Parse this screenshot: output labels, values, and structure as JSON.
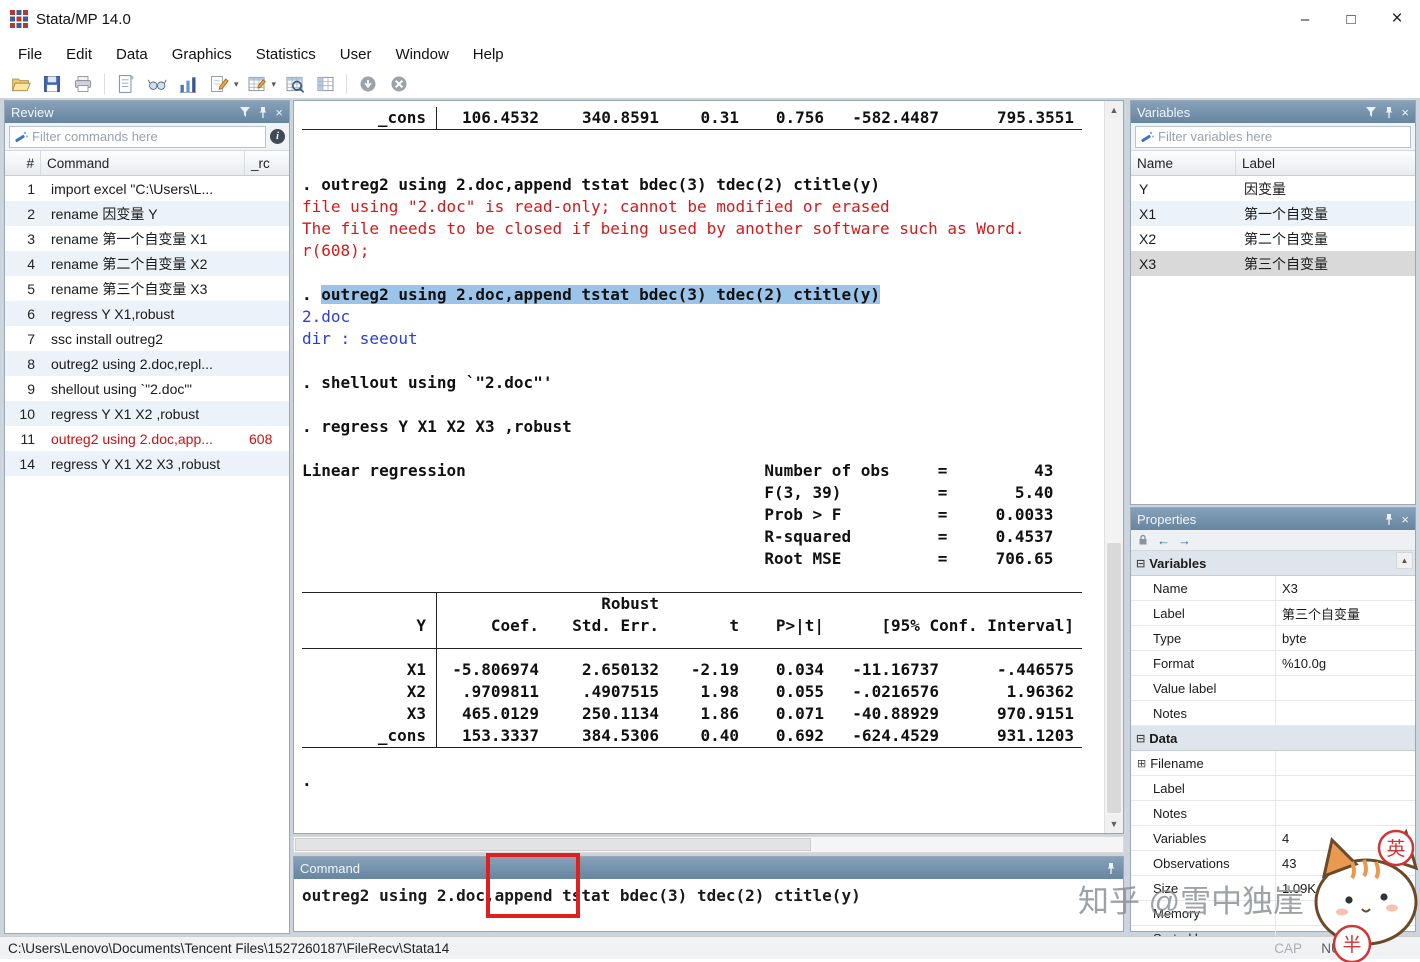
{
  "window": {
    "title": "Stata/MP 14.0",
    "minimize": "–",
    "maximize": "□",
    "close": "×"
  },
  "menu": {
    "items": [
      "File",
      "Edit",
      "Data",
      "Graphics",
      "Statistics",
      "User",
      "Window",
      "Help"
    ]
  },
  "toolbar": {
    "buttons": [
      "open",
      "save",
      "print",
      "log",
      "viewer",
      "graph",
      "do-editor",
      "data-editor",
      "data-browser",
      "variables-manager",
      "clear-more",
      "break"
    ]
  },
  "review": {
    "title": "Review",
    "filter_placeholder": "Filter commands here",
    "columns": [
      "#",
      "Command",
      "_rc"
    ],
    "rows": [
      {
        "n": "1",
        "cmd": "import excel \"C:\\Users\\L...",
        "rc": ""
      },
      {
        "n": "2",
        "cmd": "rename 因变量 Y",
        "rc": ""
      },
      {
        "n": "3",
        "cmd": "rename 第一个自变量 X1",
        "rc": ""
      },
      {
        "n": "4",
        "cmd": "rename 第二个自变量 X2",
        "rc": ""
      },
      {
        "n": "5",
        "cmd": "rename 第三个自变量 X3",
        "rc": ""
      },
      {
        "n": "6",
        "cmd": "regress Y X1,robust",
        "rc": ""
      },
      {
        "n": "7",
        "cmd": "ssc install outreg2",
        "rc": ""
      },
      {
        "n": "8",
        "cmd": "outreg2 using 2.doc,repl...",
        "rc": ""
      },
      {
        "n": "9",
        "cmd": "shellout using `\"2.doc\"'",
        "rc": ""
      },
      {
        "n": "10",
        "cmd": "regress Y X1 X2 ,robust",
        "rc": ""
      },
      {
        "n": "11",
        "cmd": "outreg2 using 2.doc,app...",
        "rc": "608",
        "error": true
      },
      {
        "n": "14",
        "cmd": "regress Y X1 X2 X3 ,robust",
        "rc": ""
      }
    ]
  },
  "output": {
    "blocks": [
      {
        "type": "partial",
        "row": {
          "name": "_cons",
          "values": [
            "106.4532",
            "340.8591",
            "0.31",
            "0.756",
            "-582.4487",
            "795.3551"
          ]
        }
      },
      {
        "type": "lines",
        "lines": [
          {
            "s": "blank"
          },
          {
            "s": "blank"
          },
          {
            "s": "cmd",
            "t": ". outreg2 using 2.doc,append tstat bdec(3) tdec(2) ctitle(y)"
          },
          {
            "s": "err",
            "t": "file using \"2.doc\" is read-only; cannot be modified or erased"
          },
          {
            "s": "err",
            "t": "The file needs to be closed if being used by another software such as Word."
          },
          {
            "s": "err",
            "t": "r(608);"
          },
          {
            "s": "blank"
          },
          {
            "s": "cmdsel",
            "pre": ". ",
            "t": "outreg2 using 2.doc,append tstat bdec(3) tdec(2) ctitle(y)"
          },
          {
            "s": "link",
            "t": "2.doc"
          },
          {
            "s": "link",
            "t": "dir : seeout"
          },
          {
            "s": "blank"
          },
          {
            "s": "cmd",
            "t": ". shellout using `\"2.doc\"'"
          },
          {
            "s": "blank"
          },
          {
            "s": "cmd",
            "t": ". regress Y X1 X2 X3 ,robust"
          },
          {
            "s": "blank"
          },
          {
            "s": "plain",
            "t": "Linear regression                               Number of obs     =         43"
          },
          {
            "s": "plain",
            "t": "                                                F(3, 39)          =       5.40"
          },
          {
            "s": "plain",
            "t": "                                                Prob > F          =     0.0033"
          },
          {
            "s": "plain",
            "t": "                                                R-squared         =     0.4537"
          },
          {
            "s": "plain",
            "t": "                                                Root MSE          =     706.65"
          },
          {
            "s": "blank"
          }
        ]
      },
      {
        "type": "coef",
        "table": {
          "robust_label": "Robust",
          "depvar": "Y",
          "headers": [
            "Coef.",
            "Std. Err.",
            "t",
            "P>|t|",
            "[95% Conf. Interval]"
          ],
          "rows": [
            {
              "name": "X1",
              "cells": [
                "-5.806974",
                "2.650132",
                "-2.19",
                "0.034",
                "-11.16737",
                "-.446575"
              ]
            },
            {
              "name": "X2",
              "cells": [
                ".9709811",
                ".4907515",
                "1.98",
                "0.055",
                "-.0216576",
                "1.96362"
              ]
            },
            {
              "name": "X3",
              "cells": [
                "465.0129",
                "250.1134",
                "1.86",
                "0.071",
                "-40.88929",
                "970.9151"
              ]
            },
            {
              "name": "_cons",
              "cells": [
                "153.3337",
                "384.5306",
                "0.40",
                "0.692",
                "-624.4529",
                "931.1203"
              ]
            }
          ]
        }
      },
      {
        "type": "lines",
        "lines": [
          {
            "s": "blank"
          },
          {
            "s": "cmd",
            "t": "."
          }
        ]
      }
    ]
  },
  "variables_panel": {
    "title": "Variables",
    "filter_placeholder": "Filter variables here",
    "columns": [
      "Name",
      "Label"
    ],
    "rows": [
      {
        "name": "Y",
        "label": "因变量"
      },
      {
        "name": "X1",
        "label": "第一个自变量"
      },
      {
        "name": "X2",
        "label": "第二个自变量"
      },
      {
        "name": "X3",
        "label": "第三个自变量",
        "selected": true
      }
    ]
  },
  "properties": {
    "title": "Properties",
    "sections": [
      {
        "header": "Variables",
        "rows": [
          {
            "k": "Name",
            "v": "X3"
          },
          {
            "k": "Label",
            "v": "第三个自变量"
          },
          {
            "k": "Type",
            "v": "byte"
          },
          {
            "k": "Format",
            "v": "%10.0g"
          },
          {
            "k": "Value label",
            "v": ""
          },
          {
            "k": "Notes",
            "v": ""
          }
        ]
      },
      {
        "header": "Data",
        "rows": [
          {
            "k": "Filename",
            "v": "",
            "expand": true
          },
          {
            "k": "Label",
            "v": ""
          },
          {
            "k": "Notes",
            "v": ""
          },
          {
            "k": "Variables",
            "v": "4"
          },
          {
            "k": "Observations",
            "v": "43"
          },
          {
            "k": "Size",
            "v": "1.09K"
          },
          {
            "k": "Memory",
            "v": ""
          },
          {
            "k": "Sorted by",
            "v": ""
          }
        ]
      }
    ]
  },
  "command_window": {
    "title": "Command",
    "text": "outreg2 using 2.doc,append tstat bdec(3) tdec(2) ctitle(y)",
    "annotated_word": "append"
  },
  "status_bar": {
    "path": "C:\\Users\\Lenovo\\Documents\\Tencent Files\\1527260187\\FileRecv\\Stata14",
    "cap": "CAP",
    "num": "NUM"
  },
  "watermark": {
    "text": "知乎 @雪中独崖",
    "badge1": "英",
    "badge2": "半"
  }
}
